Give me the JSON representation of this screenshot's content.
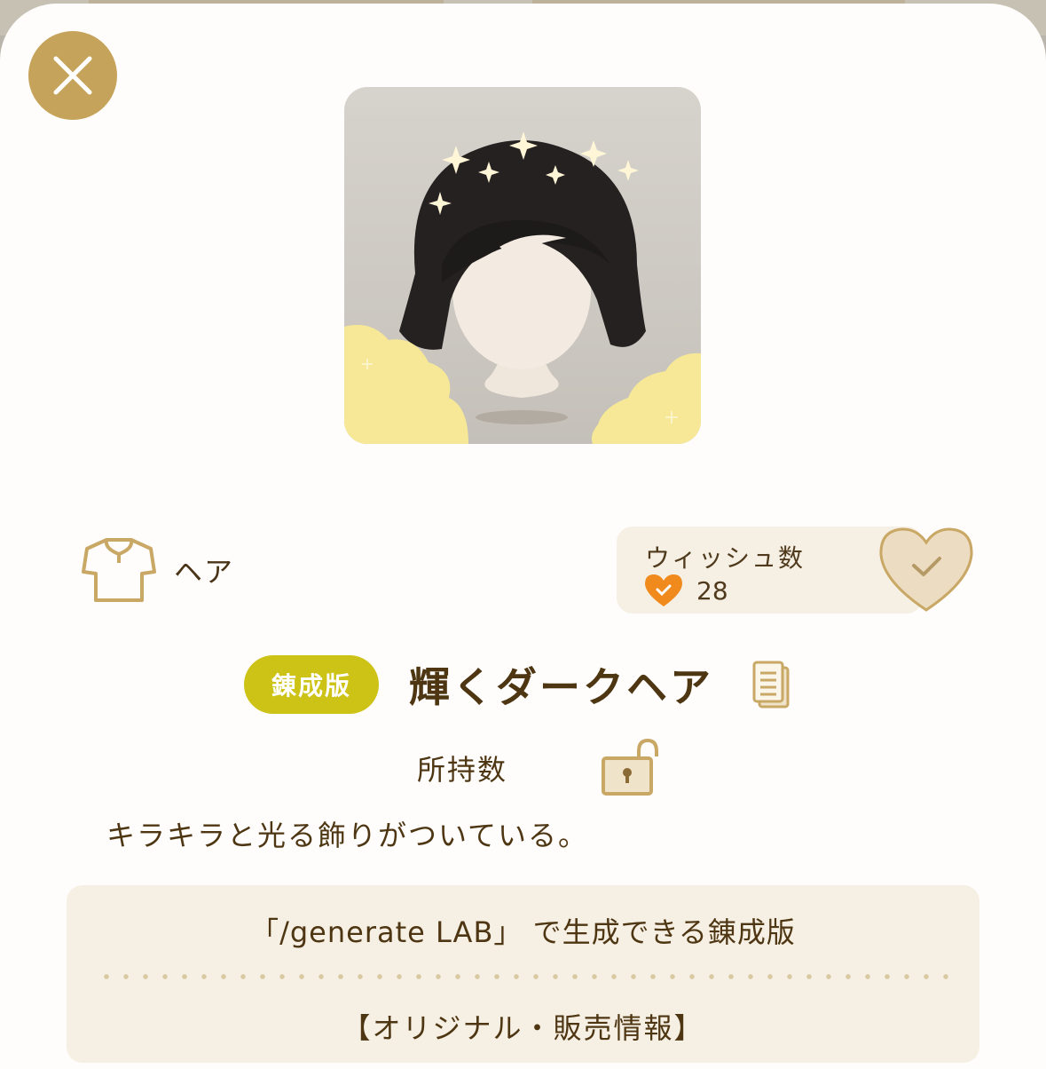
{
  "item": {
    "category": "ヘア",
    "badge": "錬成版",
    "name": "輝くダークヘア",
    "owned_label": "所持数",
    "description": "キラキラと光る飾りがついている。"
  },
  "wish": {
    "title": "ウィッシュ数",
    "count": "28"
  },
  "info": {
    "line1": "「/generate LAB」 で生成できる錬成版",
    "line2": "【オリジナル・販売情報】"
  },
  "icons": {
    "close": "close-icon",
    "category": "shirt-icon",
    "wish_heart": "heart-icon",
    "wish_button": "heart-check-icon",
    "copy": "copy-icon",
    "lock": "unlock-icon"
  },
  "colors": {
    "accent_gold": "#c6a35a",
    "badge_yellow": "#cdc216",
    "heart_orange": "#f08a1c",
    "panel_beige": "#f6efe3",
    "text_brown": "#4e3613"
  }
}
